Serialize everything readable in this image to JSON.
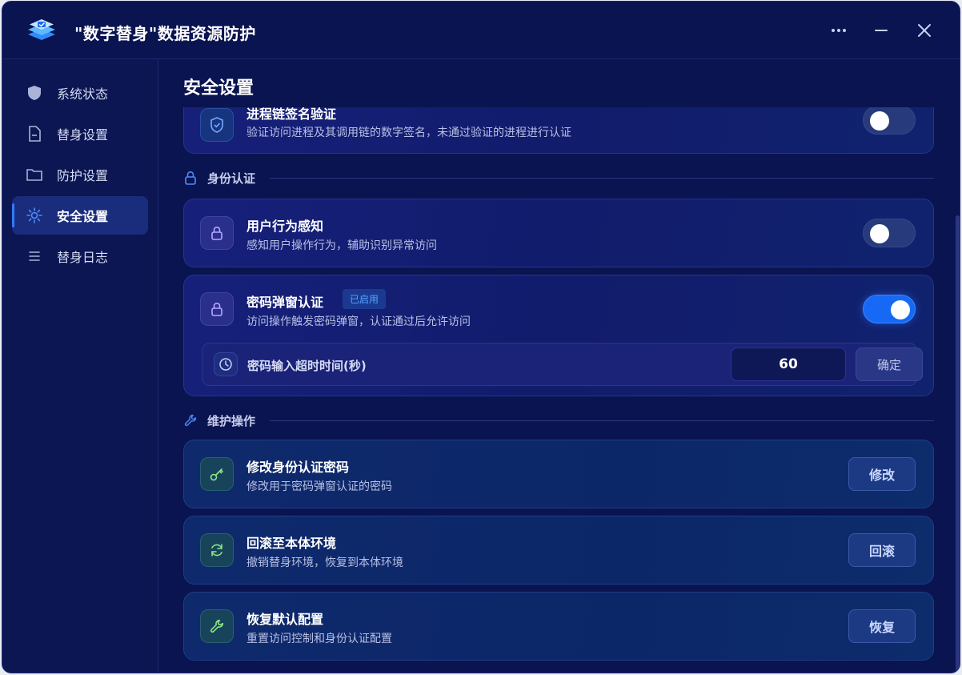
{
  "app": {
    "title": "\"数字替身\"数据资源防护"
  },
  "sidebar": {
    "items": [
      {
        "label": "系统状态",
        "icon": "shield-icon"
      },
      {
        "label": "替身设置",
        "icon": "file-icon"
      },
      {
        "label": "防护设置",
        "icon": "folder-icon"
      },
      {
        "label": "安全设置",
        "icon": "gear-icon",
        "active": true
      },
      {
        "label": "替身日志",
        "icon": "list-icon"
      }
    ]
  },
  "main": {
    "page_title": "安全设置",
    "process_chain": {
      "title": "进程链签名验证",
      "desc": "验证访问进程及其调用链的数字签名，未通过验证的进程进行认证",
      "enabled": false
    },
    "section_identity": "身份认证",
    "user_behavior": {
      "title": "用户行为感知",
      "desc": "感知用户操作行为，辅助识别异常访问",
      "enabled": false
    },
    "password_popup": {
      "title": "密码弹窗认证",
      "badge": "已启用",
      "desc": "访问操作触发密码弹窗，认证通过后允许访问",
      "enabled": true,
      "timeout_label": "密码输入超时时间(秒)",
      "timeout_value": "60",
      "confirm_label": "确定"
    },
    "section_maintenance": "维护操作",
    "change_password": {
      "title": "修改身份认证密码",
      "desc": "修改用于密码弹窗认证的密码",
      "button": "修改"
    },
    "rollback": {
      "title": "回滚至本体环境",
      "desc": "撤销替身环境，恢复到本体环境",
      "button": "回滚"
    },
    "restore": {
      "title": "恢复默认配置",
      "desc": "重置访问控制和身份认证配置",
      "button": "恢复"
    }
  },
  "colors": {
    "background": "#0a1450",
    "accent": "#1769f5",
    "card": "#16207a"
  }
}
